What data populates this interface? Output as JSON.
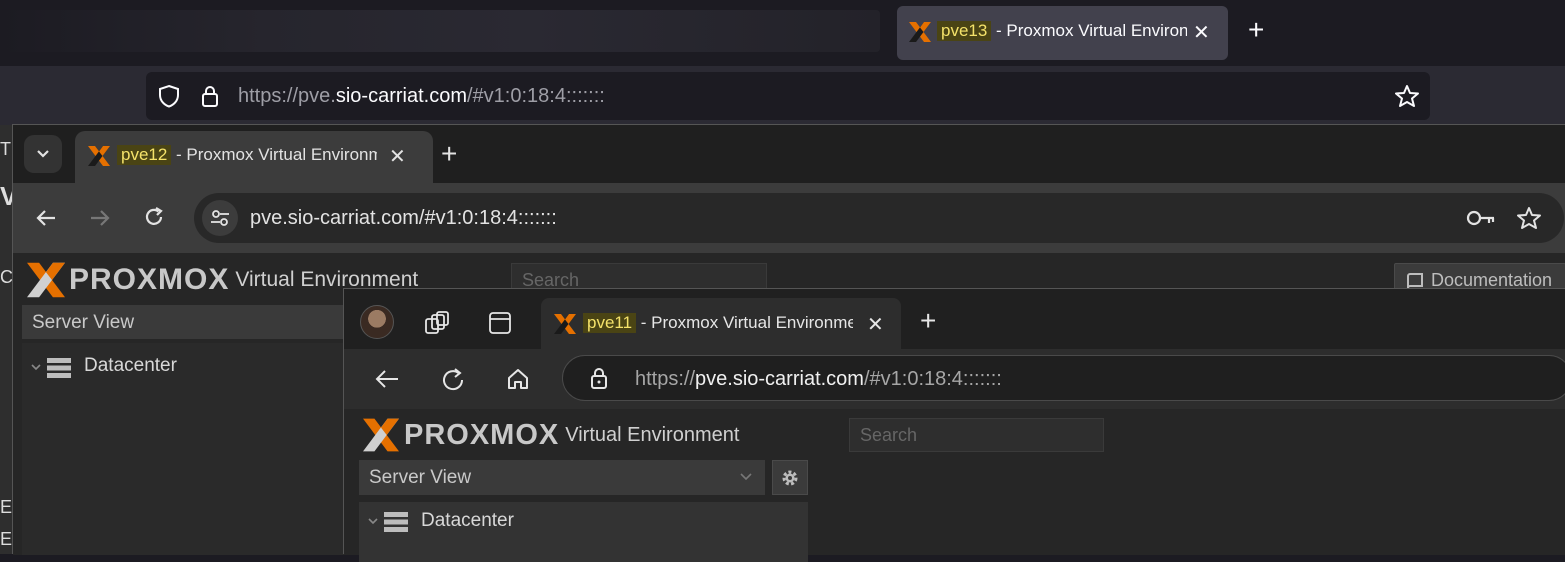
{
  "firefox": {
    "tab_site": "pve13",
    "tab_title_rest": " - Proxmox Virtual Environment",
    "tab_close": "✕",
    "new_tab": "+",
    "url_prefix": "https://pve.",
    "url_domain": "sio-carriat.com",
    "url_path": "/#v1:0:18:4:::::::",
    "left_edge_chars": [
      "T",
      "V",
      "Cl",
      "ES",
      "EI"
    ]
  },
  "chrome": {
    "tab_site": "pve12",
    "tab_title_rest": " - Proxmox Virtual Environment",
    "tab_close": "✕",
    "new_tab": "+",
    "url": "pve.sio-carriat.com/#v1:0:18:4:::::::",
    "page": {
      "logo_text": "PROXMOX",
      "product": "Virtual Environment",
      "search_placeholder": "Search",
      "documentation_label": "Documentation",
      "view_select": "Server View",
      "tree_root": "Datacenter"
    }
  },
  "edge": {
    "tab_site": "pve11",
    "tab_title_rest": " - Proxmox Virtual Environment",
    "tab_close": "✕",
    "new_tab": "+",
    "url_prefix": "https://",
    "url_domain": "pve.sio-carriat.com",
    "url_path": "/#v1:0:18:4:::::::",
    "page": {
      "logo_text": "PROXMOX",
      "product": "Virtual Environment",
      "search_placeholder": "Search",
      "view_select": "Server View",
      "tree_root": "Datacenter"
    }
  },
  "colors": {
    "proxmox_orange": "#e57000",
    "highlight_bg": "#4a4414",
    "highlight_fg": "#f4e26a"
  }
}
